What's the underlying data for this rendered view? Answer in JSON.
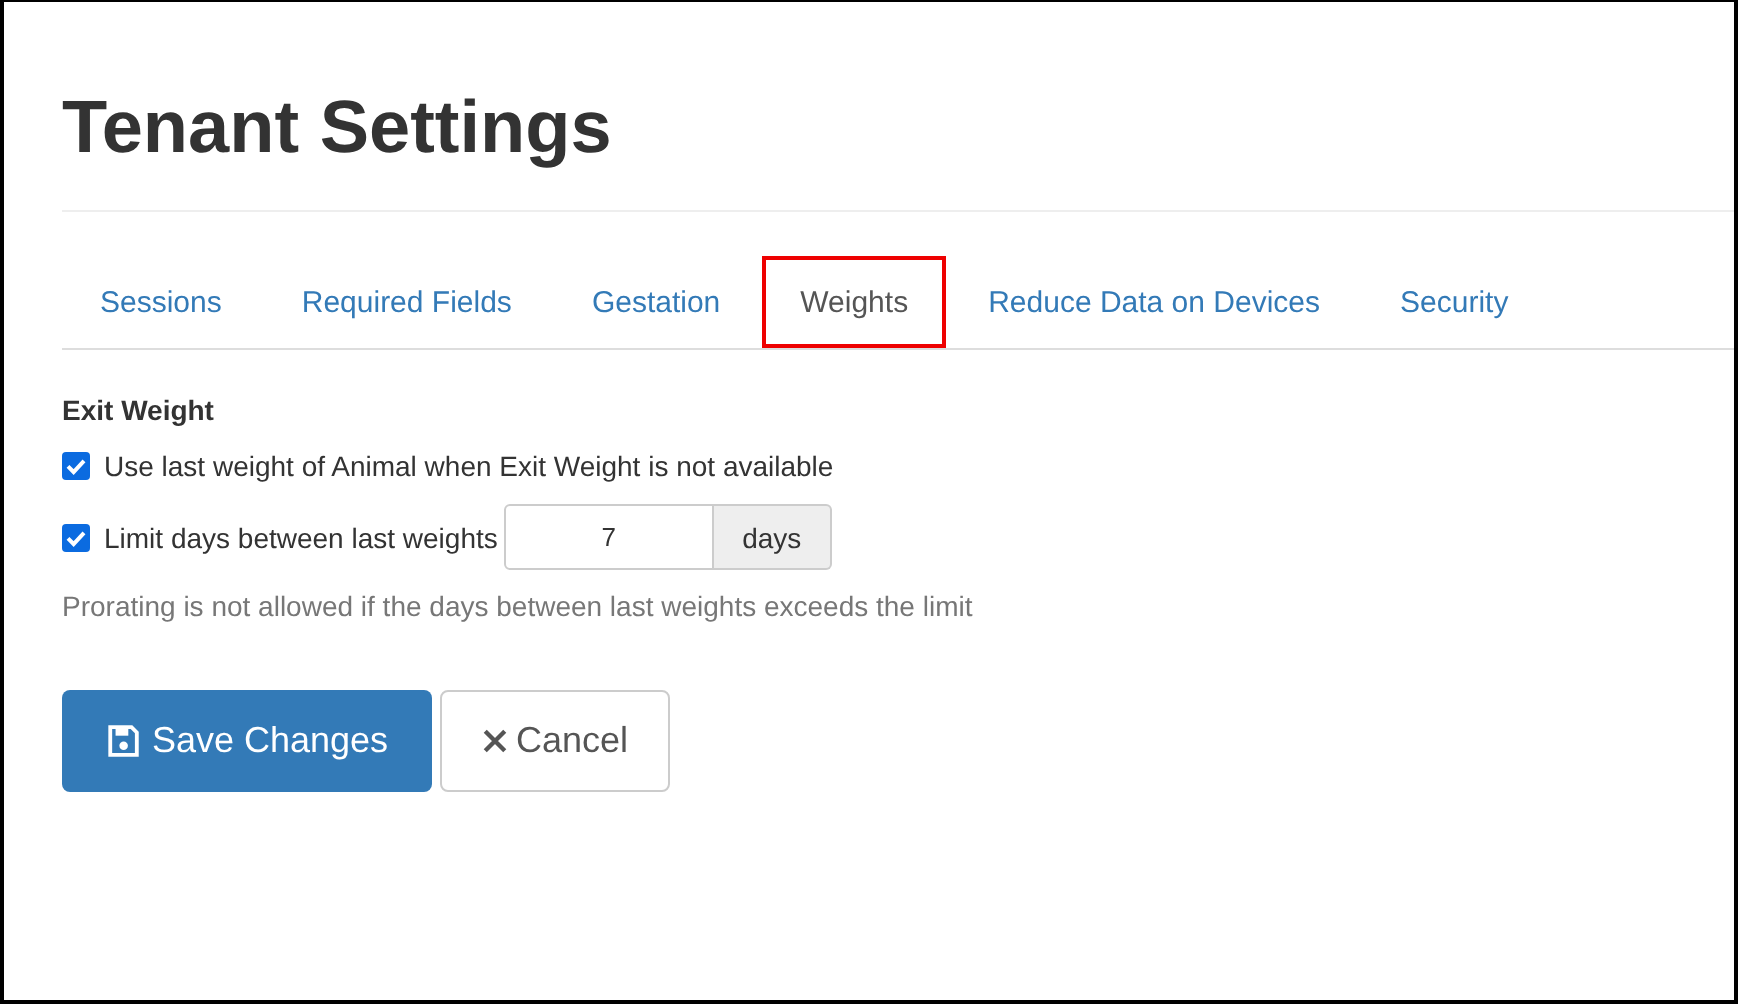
{
  "title": "Tenant Settings",
  "tabs": [
    {
      "label": "Sessions",
      "selected": false
    },
    {
      "label": "Required Fields",
      "selected": false
    },
    {
      "label": "Gestation",
      "selected": false
    },
    {
      "label": "Weights",
      "selected": true
    },
    {
      "label": "Reduce Data on Devices",
      "selected": false
    },
    {
      "label": "Security",
      "selected": false
    }
  ],
  "section": {
    "heading": "Exit Weight",
    "use_last_weight": {
      "label": "Use last weight of Animal when Exit Weight is not available",
      "checked": true
    },
    "limit_days": {
      "label": "Limit days between last weights",
      "checked": true,
      "value": "7",
      "unit": "days"
    },
    "help": "Prorating is not allowed if the days between last weights exceeds the limit"
  },
  "buttons": {
    "save": "Save Changes",
    "cancel": "Cancel"
  }
}
